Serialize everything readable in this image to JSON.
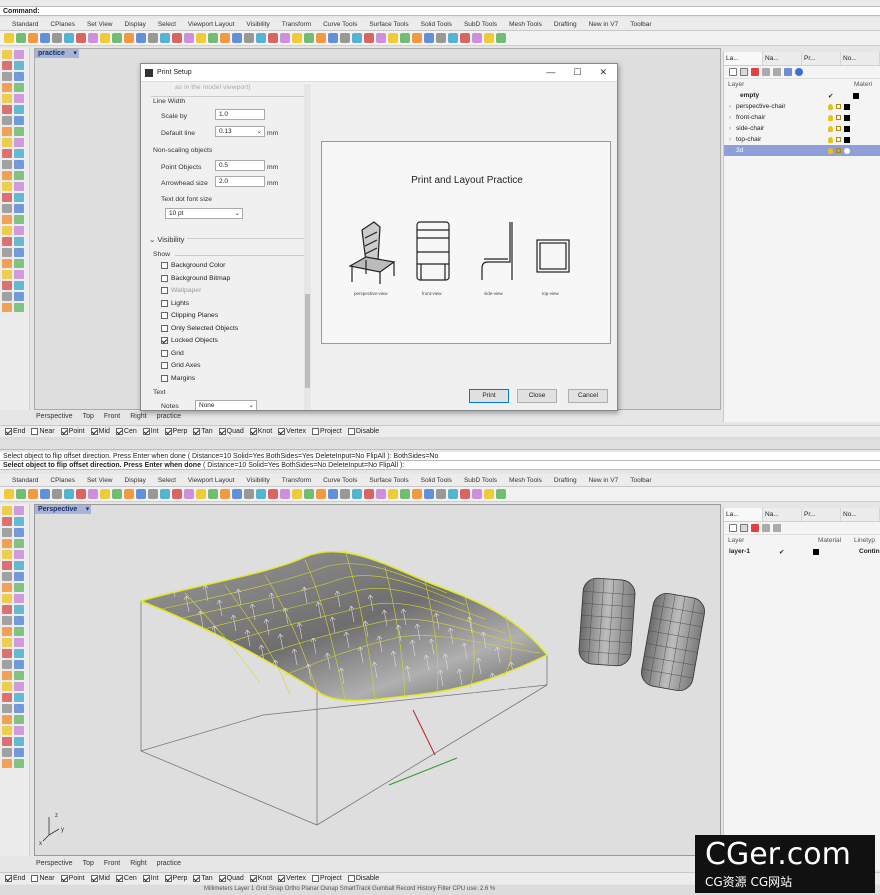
{
  "top": {
    "command_label": "Command:",
    "toolbar_tabs": [
      "Standard",
      "CPlanes",
      "Set View",
      "Display",
      "Select",
      "Viewport Layout",
      "Visibility",
      "Transform",
      "Curve Tools",
      "Surface Tools",
      "Solid Tools",
      "SubD Tools",
      "Mesh Tools",
      "Drafting",
      "New in V7",
      "Toolbar"
    ],
    "viewport_label": "practice",
    "viewport_tabs": [
      "Perspective",
      "Top",
      "Front",
      "Right",
      "practice"
    ],
    "osnaps": [
      {
        "label": "End",
        "on": true
      },
      {
        "label": "Near",
        "on": false
      },
      {
        "label": "Point",
        "on": true
      },
      {
        "label": "Mid",
        "on": true
      },
      {
        "label": "Cen",
        "on": true
      },
      {
        "label": "Int",
        "on": true
      },
      {
        "label": "Perp",
        "on": true
      },
      {
        "label": "Tan",
        "on": true
      },
      {
        "label": "Quad",
        "on": true
      },
      {
        "label": "Knot",
        "on": true
      },
      {
        "label": "Vertex",
        "on": true
      },
      {
        "label": "Project",
        "on": false
      },
      {
        "label": "Disable",
        "on": false
      }
    ],
    "panel": {
      "tabs": [
        "La...",
        "Na...",
        "Pr...",
        "No..."
      ],
      "header_layer": "Layer",
      "header_material": "Materi",
      "layers": [
        {
          "name": "empty",
          "current": true
        },
        {
          "name": "perspective-chair"
        },
        {
          "name": "front-chair"
        },
        {
          "name": "side-chair"
        },
        {
          "name": "top-chair"
        },
        {
          "name": "3d",
          "selected": true
        }
      ]
    }
  },
  "dialog": {
    "title": "Print Setup",
    "faded_text": "as in the model viewport)",
    "line_width": {
      "section": "Line Width",
      "scale_by_label": "Scale by",
      "scale_by_value": "1.0",
      "default_line_label": "Default line",
      "default_line_value": "0.13",
      "unit": "mm"
    },
    "non_scaling": {
      "section": "Non-scaling objects",
      "point_label": "Point Objects",
      "point_value": "0.5",
      "arrow_label": "Arrowhead size",
      "arrow_value": "2.0",
      "unit": "mm",
      "font_label": "Text dot font size",
      "font_value": "10 pt"
    },
    "visibility": {
      "section": "Visibility",
      "show_label": "Show",
      "items": [
        {
          "label": "Background Color",
          "checked": false
        },
        {
          "label": "Background Bitmap",
          "checked": false
        },
        {
          "label": "Wallpaper",
          "checked": false,
          "disabled": true
        },
        {
          "label": "Lights",
          "checked": false
        },
        {
          "label": "Clipping Planes",
          "checked": false
        },
        {
          "label": "Only Selected Objects",
          "checked": false
        },
        {
          "label": "Locked Objects",
          "checked": true
        },
        {
          "label": "Grid",
          "checked": false
        },
        {
          "label": "Grid Axes",
          "checked": false
        },
        {
          "label": "Margins",
          "checked": false
        }
      ]
    },
    "text_section": "Text",
    "notes_label": "Notes",
    "notes_value": "None",
    "preview_title": "Print and Layout Practice",
    "captions": [
      "perspective-view",
      "front-view",
      "side-view",
      "top-view"
    ],
    "buttons": {
      "print": "Print",
      "close": "Close",
      "cancel": "Cancel"
    }
  },
  "bottom": {
    "history_line": "Select object to flip offset direction. Press Enter when done ( Distance=10  Solid=Yes  BothSides=Yes  DeleteInput=No  FlipAll ): BothSides=No",
    "prompt_bold": "Select object to flip offset direction. Press Enter when done",
    "prompt_opts": "( Distance=10  Solid=Yes  BothSides=No  DeleteInput=No  FlipAll ):",
    "toolbar_tabs": [
      "Standard",
      "CPlanes",
      "Set View",
      "Display",
      "Select",
      "Viewport Layout",
      "Visibility",
      "Transform",
      "Curve Tools",
      "Surface Tools",
      "Solid Tools",
      "SubD Tools",
      "Mesh Tools",
      "Drafting",
      "New in V7",
      "Toolbar"
    ],
    "viewport_label": "Perspective",
    "viewport_tabs": [
      "Perspective",
      "Top",
      "Front",
      "Right",
      "practice"
    ],
    "axis_z": "z",
    "axis_y": "y",
    "axis_x": "x",
    "panel": {
      "tabs": [
        "La...",
        "Na...",
        "Pr...",
        "No..."
      ],
      "header_layer": "Layer",
      "header_material": "Material",
      "header_linetype": "Linetyp",
      "layer_name": "layer-1",
      "layer_linetype": "Contin"
    },
    "status_text": "Millimeters    Layer 1        Grid Snap   Ortho   Planar   Osnap   SmartTrack   Gumball   Record History   Filter   CPU use: 2.6 %"
  },
  "watermark": {
    "big": "CGer.com",
    "small": "CG资源 CG网站"
  }
}
